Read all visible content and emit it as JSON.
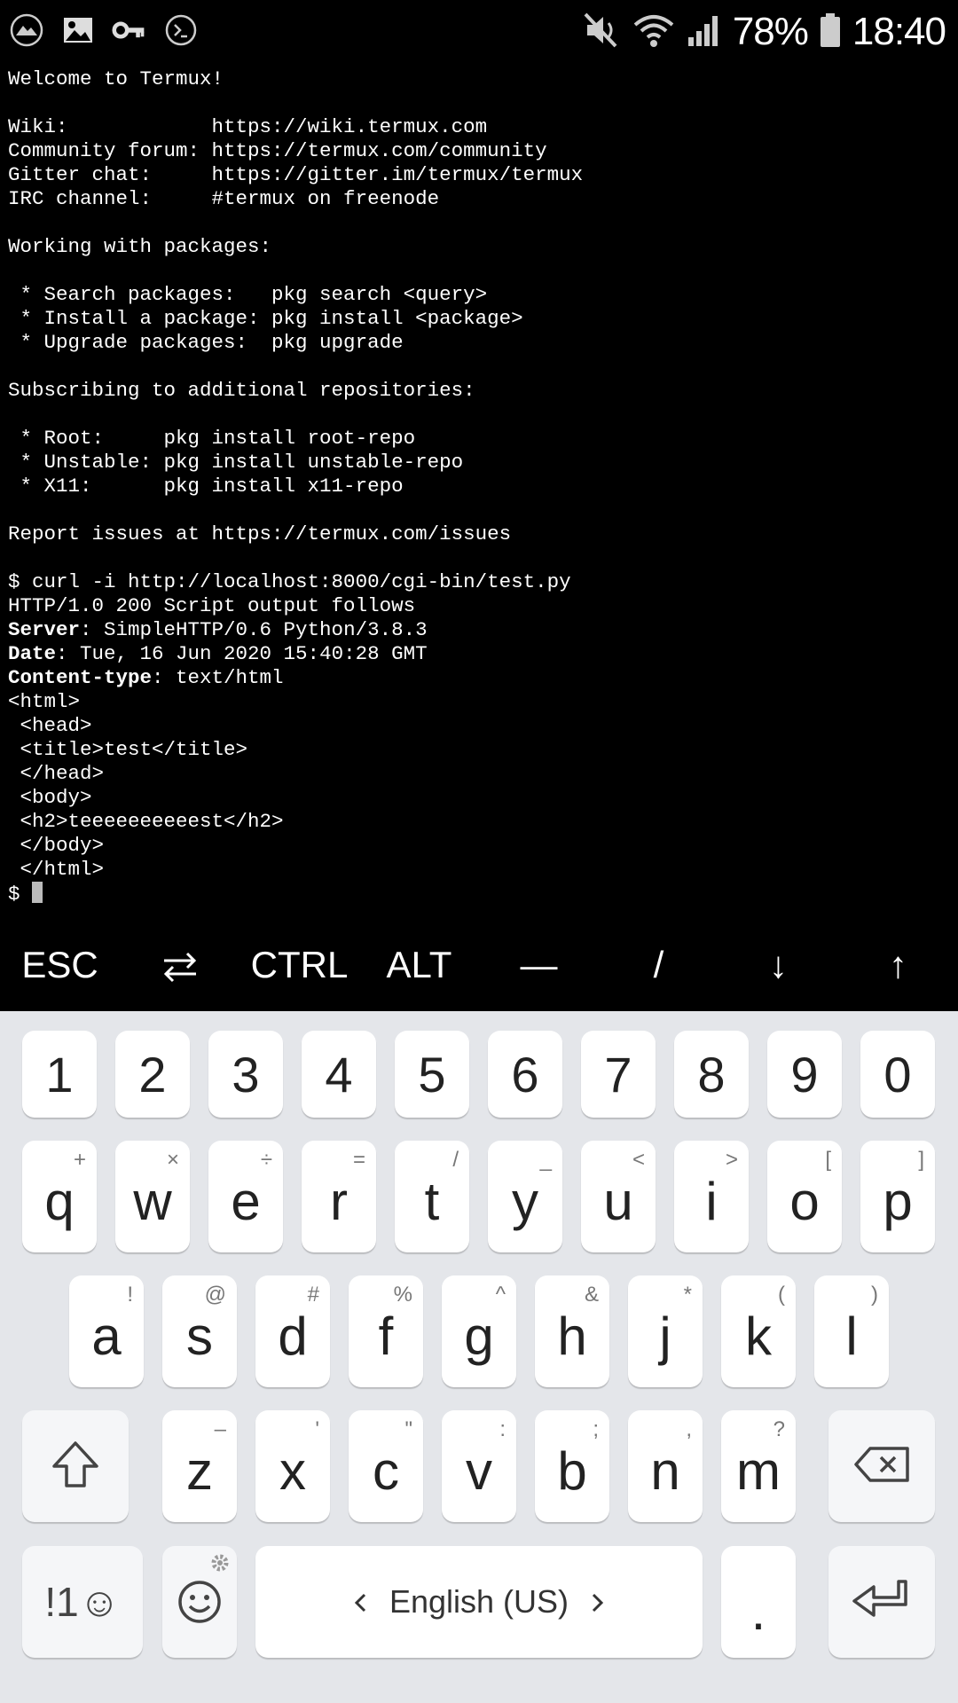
{
  "status_bar": {
    "left_icons": [
      "alpine-icon",
      "gallery-icon",
      "key-icon",
      "terminal-icon"
    ],
    "battery": "78%",
    "time": "18:40"
  },
  "terminal": {
    "lines": [
      [
        {
          "t": "Welcome to Termux!"
        }
      ],
      [],
      [
        {
          "t": "Wiki:            https://wiki.termux.com"
        }
      ],
      [
        {
          "t": "Community forum: https://termux.com/community"
        }
      ],
      [
        {
          "t": "Gitter chat:     https://gitter.im/termux/termux"
        }
      ],
      [
        {
          "t": "IRC channel:     #termux on freenode"
        }
      ],
      [],
      [
        {
          "t": "Working with packages:"
        }
      ],
      [],
      [
        {
          "t": " * Search packages:   pkg search <query>"
        }
      ],
      [
        {
          "t": " * Install a package: pkg install <package>"
        }
      ],
      [
        {
          "t": " * Upgrade packages:  pkg upgrade"
        }
      ],
      [],
      [
        {
          "t": "Subscribing to additional repositories:"
        }
      ],
      [],
      [
        {
          "t": " * Root:     pkg install root-repo"
        }
      ],
      [
        {
          "t": " * Unstable: pkg install unstable-repo"
        }
      ],
      [
        {
          "t": " * X11:      pkg install x11-repo"
        }
      ],
      [],
      [
        {
          "t": "Report issues at https://termux.com/issues"
        }
      ],
      [],
      [
        {
          "t": "$ curl -i http://localhost:8000/cgi-bin/test.py"
        }
      ],
      [
        {
          "t": "HTTP/1.0 200 Script output follows"
        }
      ],
      [
        {
          "t": "Server",
          "b": true
        },
        {
          "t": ": SimpleHTTP/0.6 Python/3.8.3"
        }
      ],
      [
        {
          "t": "Date",
          "b": true
        },
        {
          "t": ": Tue, 16 Jun 2020 15:40:28 GMT"
        }
      ],
      [
        {
          "t": "Content-type",
          "b": true
        },
        {
          "t": ": text/html"
        }
      ],
      [
        {
          "t": "<html>"
        }
      ],
      [
        {
          "t": " <head>"
        }
      ],
      [
        {
          "t": " <title>test</title>"
        }
      ],
      [
        {
          "t": " </head>"
        }
      ],
      [
        {
          "t": " <body>"
        }
      ],
      [
        {
          "t": " <h2>teeeeeeeeeest</h2>"
        }
      ],
      [
        {
          "t": " </body>"
        }
      ],
      [
        {
          "t": " </html>"
        }
      ]
    ],
    "prompt": "$ "
  },
  "extra_keys": [
    {
      "label": "ESC",
      "name": "esc-key"
    },
    {
      "label": "",
      "icon": "swap-arrows-icon",
      "name": "tab-key"
    },
    {
      "label": "CTRL",
      "name": "ctrl-key"
    },
    {
      "label": "ALT",
      "name": "alt-key"
    },
    {
      "label": "—",
      "name": "dash-key"
    },
    {
      "label": "/",
      "name": "slash-key"
    },
    {
      "label": "↓",
      "name": "down-arrow-key"
    },
    {
      "label": "↑",
      "name": "up-arrow-key"
    }
  ],
  "keyboard": {
    "numbers": [
      "1",
      "2",
      "3",
      "4",
      "5",
      "6",
      "7",
      "8",
      "9",
      "0"
    ],
    "row1": [
      {
        "k": "q",
        "s": "+"
      },
      {
        "k": "w",
        "s": "×"
      },
      {
        "k": "e",
        "s": "÷"
      },
      {
        "k": "r",
        "s": "="
      },
      {
        "k": "t",
        "s": "/"
      },
      {
        "k": "y",
        "s": "_"
      },
      {
        "k": "u",
        "s": "<"
      },
      {
        "k": "i",
        "s": ">"
      },
      {
        "k": "o",
        "s": "["
      },
      {
        "k": "p",
        "s": "]"
      }
    ],
    "row2": [
      {
        "k": "a",
        "s": "!"
      },
      {
        "k": "s",
        "s": "@"
      },
      {
        "k": "d",
        "s": "#"
      },
      {
        "k": "f",
        "s": "%"
      },
      {
        "k": "g",
        "s": "^"
      },
      {
        "k": "h",
        "s": "&"
      },
      {
        "k": "j",
        "s": "*"
      },
      {
        "k": "k",
        "s": "("
      },
      {
        "k": "l",
        "s": ")"
      }
    ],
    "row3": [
      {
        "k": "z",
        "s": "–"
      },
      {
        "k": "x",
        "s": "'"
      },
      {
        "k": "c",
        "s": "\""
      },
      {
        "k": "v",
        "s": ":"
      },
      {
        "k": "b",
        "s": ";"
      },
      {
        "k": "n",
        "s": ","
      },
      {
        "k": "m",
        "s": "?"
      }
    ],
    "symbols_label": "!1☺",
    "space_label": "English (US)",
    "period_label": "."
  }
}
